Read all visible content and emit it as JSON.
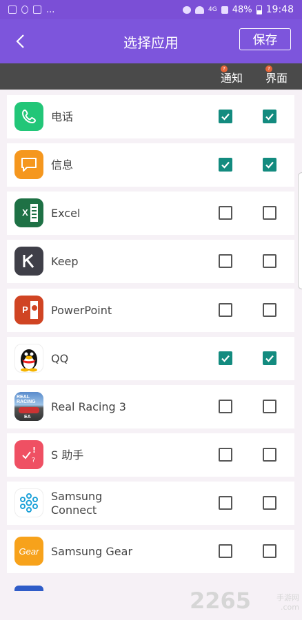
{
  "statusbar": {
    "network": "4G",
    "battery": "48%",
    "time": "19:48",
    "dots": "..."
  },
  "appbar": {
    "title": "选择应用",
    "save_label": "保存"
  },
  "columns": {
    "notify": "通知",
    "interface": "界面",
    "badge": "?"
  },
  "apps": [
    {
      "name": "电话",
      "icon": "phone-icon",
      "color": "#22c678",
      "notify": true,
      "interface": true
    },
    {
      "name": "信息",
      "icon": "message-icon",
      "color": "#f5971e",
      "notify": true,
      "interface": true
    },
    {
      "name": "Excel",
      "icon": "excel-icon",
      "color": "#1e7145",
      "notify": false,
      "interface": false
    },
    {
      "name": "Keep",
      "icon": "keep-icon",
      "color": "#3f3f48",
      "notify": false,
      "interface": false
    },
    {
      "name": "PowerPoint",
      "icon": "powerpoint-icon",
      "color": "#d04423",
      "notify": false,
      "interface": false
    },
    {
      "name": "QQ",
      "icon": "qq-penguin-icon",
      "color": "#ffffff",
      "notify": true,
      "interface": true
    },
    {
      "name": "Real Racing 3",
      "icon": "real-racing-icon",
      "color": "#3a6ea5",
      "notify": false,
      "interface": false
    },
    {
      "name": "S 助手",
      "icon": "s-assistant-icon",
      "color": "#ef5063",
      "notify": false,
      "interface": false
    },
    {
      "name": "Samsung\nConnect",
      "name_line1": "Samsung",
      "name_line2": "Connect",
      "icon": "samsung-connect-icon",
      "color": "#ffffff",
      "notify": false,
      "interface": false
    },
    {
      "name": "Samsung Gear",
      "icon": "samsung-gear-icon",
      "color": "#f7a21b",
      "notify": false,
      "interface": false
    }
  ],
  "watermark": {
    "number": "2265",
    "site": "手游网",
    "domain": ".com"
  }
}
